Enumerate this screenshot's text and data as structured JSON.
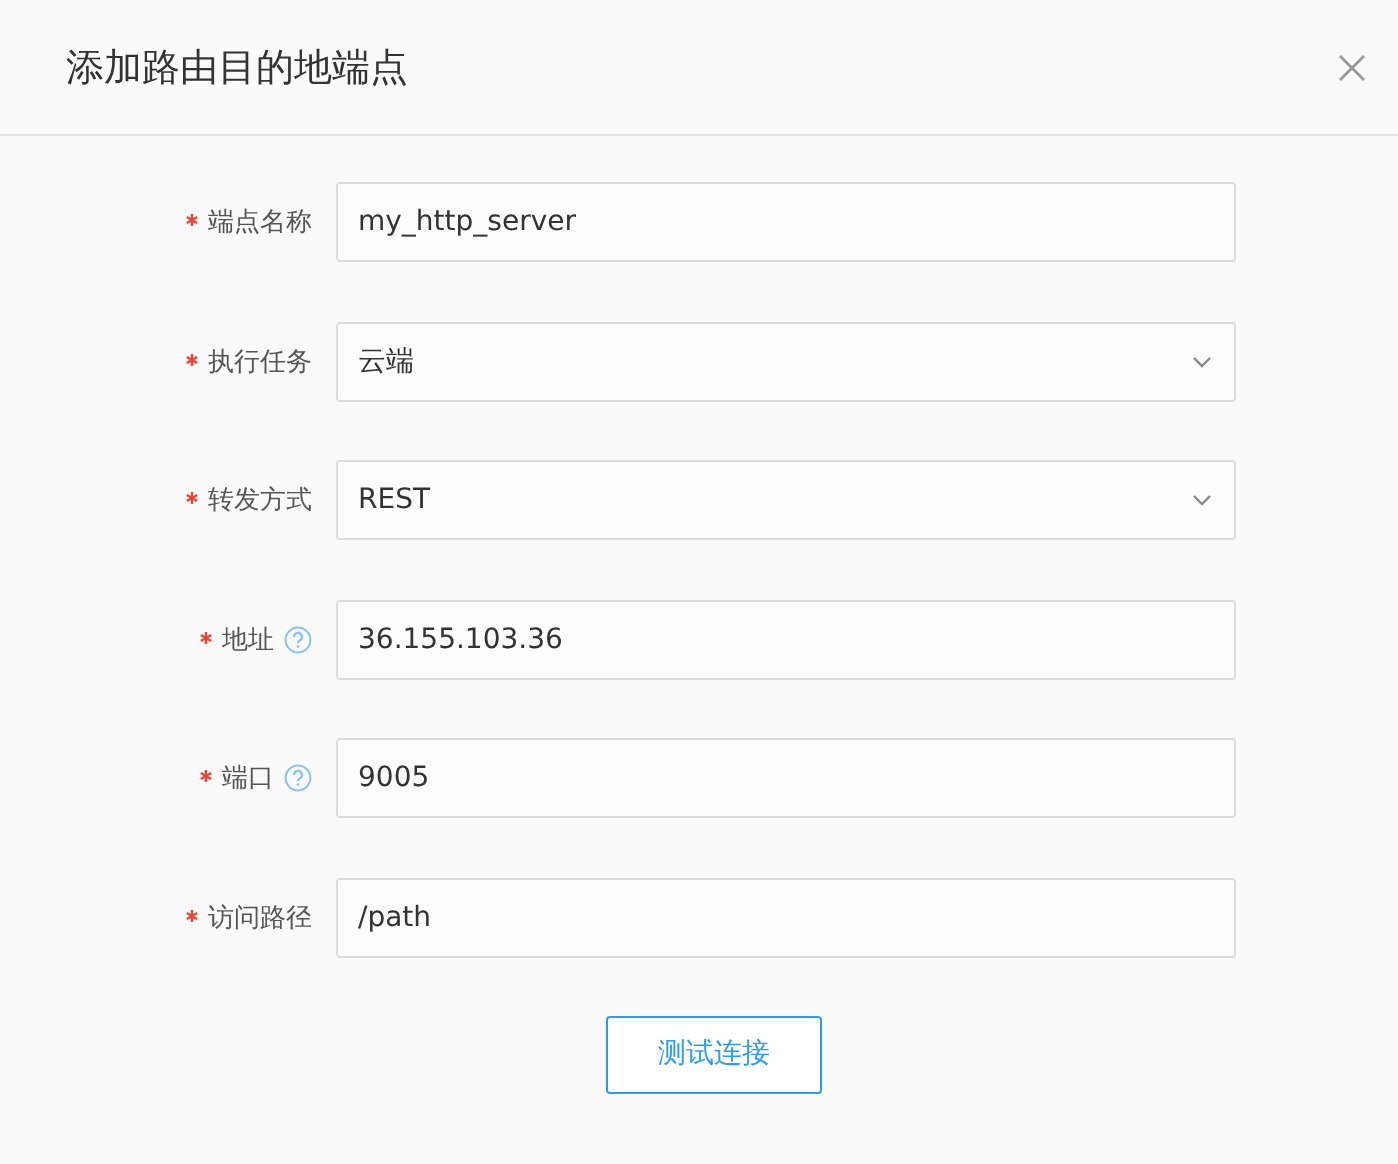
{
  "dialog": {
    "title": "添加路由目的地端点"
  },
  "fields": [
    {
      "kind": "text",
      "label": "端点名称",
      "required": true,
      "help": false,
      "value": "my_http_server"
    },
    {
      "kind": "select",
      "label": "执行任务",
      "required": true,
      "help": false,
      "value": "云端"
    },
    {
      "kind": "select",
      "label": "转发方式",
      "required": true,
      "help": false,
      "value": "REST"
    },
    {
      "kind": "text",
      "label": "地址",
      "required": true,
      "help": true,
      "value": "36.155.103.36"
    },
    {
      "kind": "text",
      "label": "端口",
      "required": true,
      "help": true,
      "value": "9005"
    },
    {
      "kind": "text",
      "label": "访问路径",
      "required": true,
      "help": false,
      "value": "/path"
    }
  ],
  "buttons": [
    "测试连接"
  ]
}
